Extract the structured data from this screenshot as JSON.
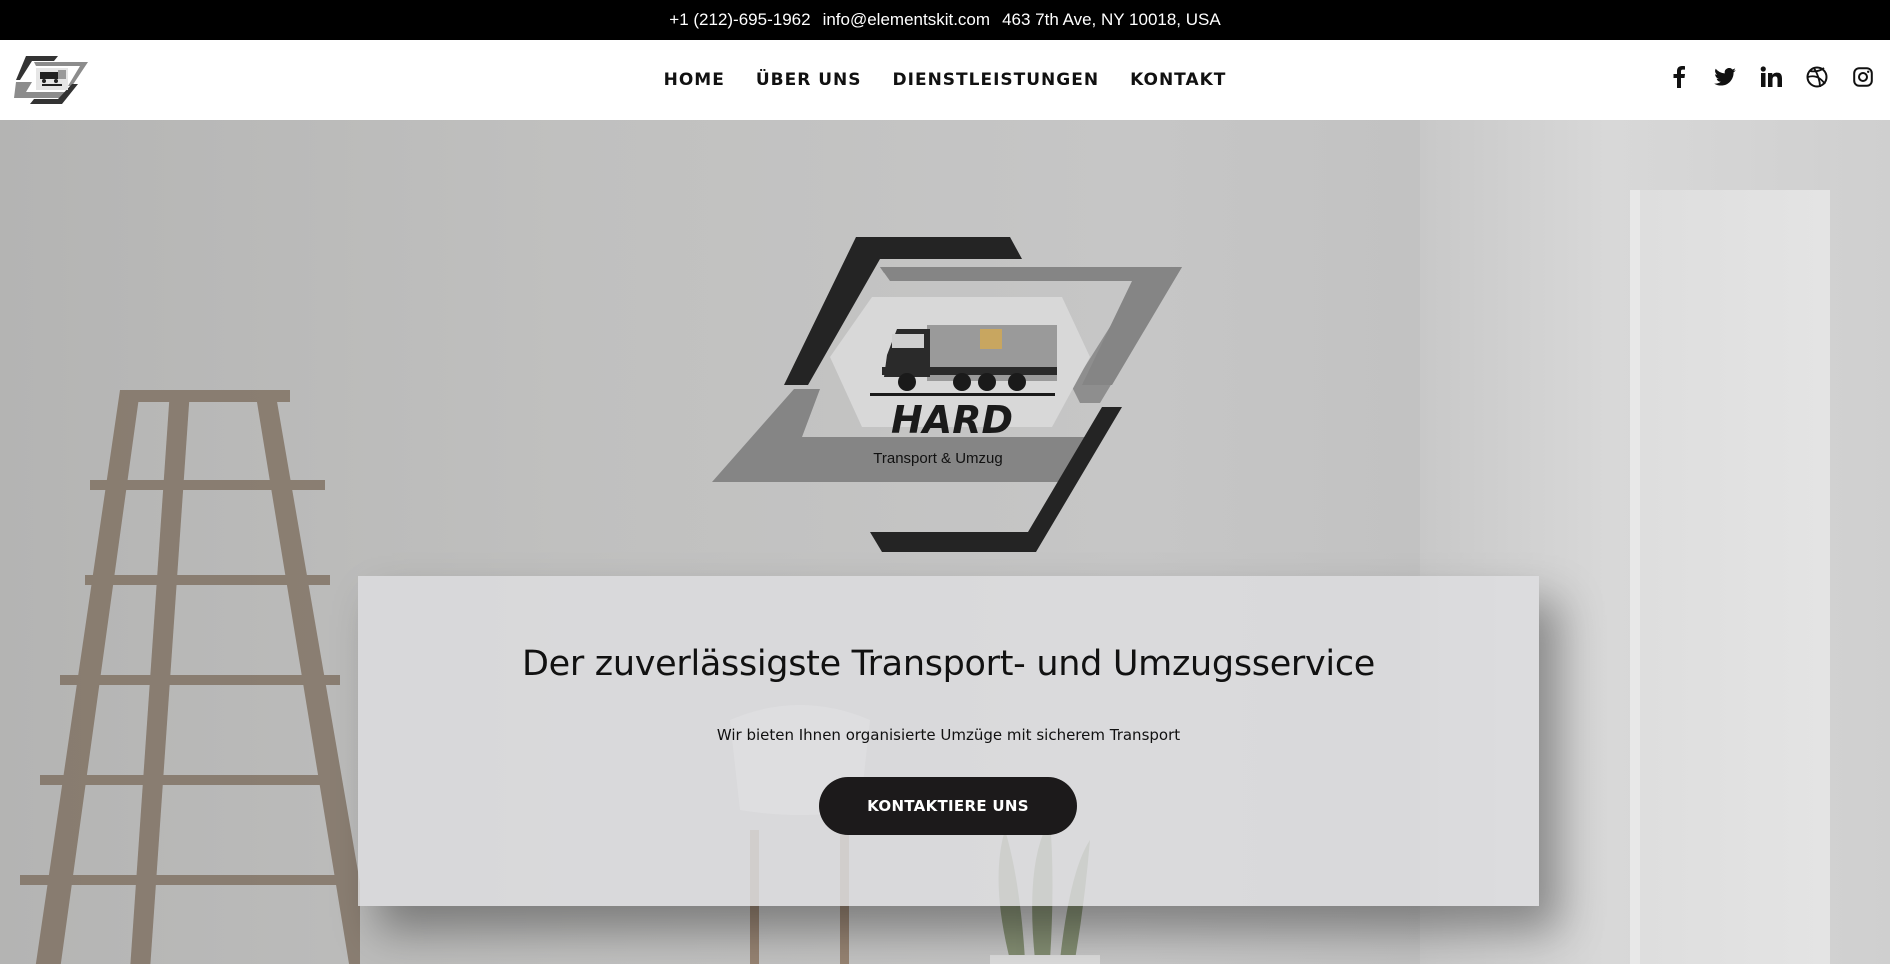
{
  "topbar": {
    "phone": "+1 (212)-695-1962",
    "email": "info@elementskit.com",
    "address": "463 7th Ave, NY 10018, USA"
  },
  "nav": {
    "items": [
      "HOME",
      "ÜBER UNS",
      "DIENSTLEISTUNGEN",
      "KONTAKT"
    ]
  },
  "social": [
    "facebook-icon",
    "twitter-icon",
    "linkedin-icon",
    "dribbble-icon",
    "instagram-icon"
  ],
  "logo": {
    "brand": "HARD",
    "tagline": "Transport & Umzug"
  },
  "hero": {
    "heading": "Der zuverlässigste Transport- und Umzugsservice",
    "subtext": "Wir bieten Ihnen  organisierte Umzüge mit sicherem Transport",
    "cta_label": "KONTAKTIERE UNS"
  },
  "colors": {
    "topbar_bg": "#000000",
    "cta_bg": "#1c1a1b",
    "logo_dark": "#222222",
    "logo_grey": "#8a8a8a"
  }
}
